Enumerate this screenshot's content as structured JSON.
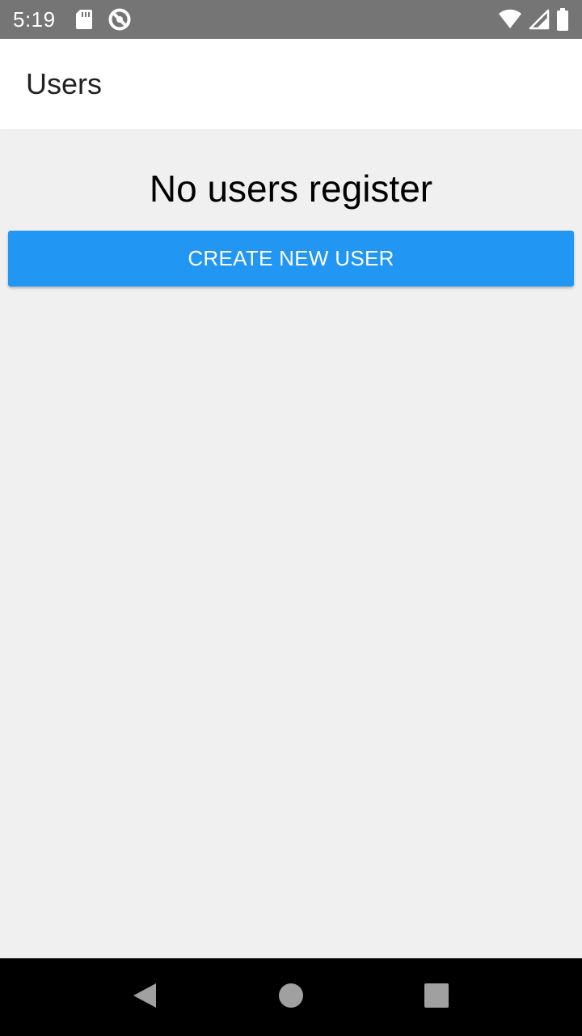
{
  "status_bar": {
    "time": "5:19",
    "left_icons": [
      "sd-card-icon",
      "no-sync-icon"
    ],
    "right_icons": [
      "wifi-icon",
      "cell-signal-icon",
      "battery-icon"
    ]
  },
  "app_bar": {
    "title": "Users"
  },
  "main": {
    "empty_message": "No users register",
    "create_button_label": "CREATE NEW USER"
  },
  "nav_bar": {
    "buttons": [
      "back-icon",
      "home-icon",
      "recents-icon"
    ]
  },
  "colors": {
    "status_bar": "#757575",
    "app_bar": "#ffffff",
    "background": "#f0f0f0",
    "accent": "#2196f3",
    "nav_bar": "#000000"
  }
}
